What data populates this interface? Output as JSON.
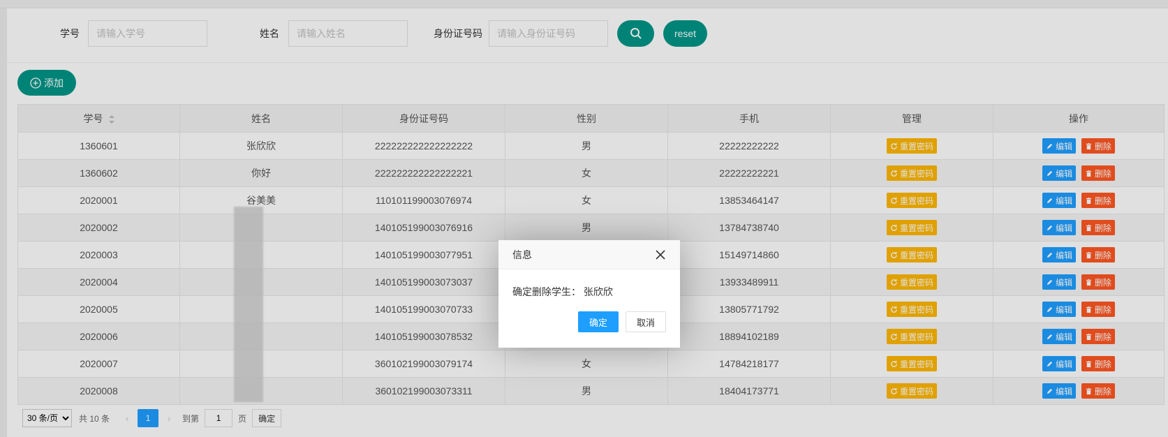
{
  "search": {
    "student_id_label": "学号",
    "student_id_placeholder": "请输入学号",
    "name_label": "姓名",
    "name_placeholder": "请输入姓名",
    "id_card_label": "身份证号码",
    "id_card_placeholder": "请输入身份证号码",
    "reset_label": "reset"
  },
  "toolbar": {
    "add_label": "添加"
  },
  "table": {
    "headers": [
      "学号",
      "姓名",
      "身份证号码",
      "性别",
      "手机",
      "管理",
      "操作"
    ],
    "action_labels": {
      "reset_password": "重置密码",
      "edit": "编辑",
      "delete": "删除"
    },
    "rows": [
      {
        "id": "1360601",
        "name": "张欣欣",
        "id_card": "222222222222222222",
        "gender": "男",
        "phone": "22222222222"
      },
      {
        "id": "1360602",
        "name": "你好",
        "id_card": "222222222222222221",
        "gender": "女",
        "phone": "22222222221"
      },
      {
        "id": "2020001",
        "name": "谷美美",
        "id_card": "110101199003076974",
        "gender": "女",
        "phone": "13853464147"
      },
      {
        "id": "2020002",
        "name": "",
        "id_card": "140105199003076916",
        "gender": "男",
        "phone": "13784738740"
      },
      {
        "id": "2020003",
        "name": "",
        "id_card": "140105199003077951",
        "gender": "",
        "phone": "15149714860"
      },
      {
        "id": "2020004",
        "name": "",
        "id_card": "140105199003073037",
        "gender": "",
        "phone": "13933489911"
      },
      {
        "id": "2020005",
        "name": "",
        "id_card": "140105199003070733",
        "gender": "",
        "phone": "13805771792"
      },
      {
        "id": "2020006",
        "name": "",
        "id_card": "140105199003078532",
        "gender": "",
        "phone": "18894102189"
      },
      {
        "id": "2020007",
        "name": "",
        "id_card": "360102199003079174",
        "gender": "女",
        "phone": "14784218177"
      },
      {
        "id": "2020008",
        "name": "",
        "id_card": "360102199003073311",
        "gender": "男",
        "phone": "18404173771"
      }
    ]
  },
  "pager": {
    "page_size": "30 条/页",
    "total": "共 10 条",
    "prev": "‹",
    "current": "1",
    "next": "›",
    "goto_label": "到第",
    "goto_value": "1",
    "page_unit": "页",
    "confirm": "确定"
  },
  "dialog": {
    "title": "信息",
    "message": "确定删除学生：  张欣欣",
    "ok": "确定",
    "cancel": "取消"
  },
  "colors": {
    "primary": "#009688",
    "blue": "#1E9FFF",
    "warn": "#FFB800",
    "danger": "#FF5722"
  }
}
